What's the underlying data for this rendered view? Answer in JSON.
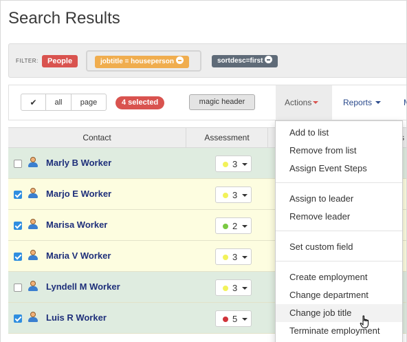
{
  "page": {
    "title": "Search Results"
  },
  "filter": {
    "label": "FILTER:",
    "tags": [
      {
        "text": "People",
        "color": "#d9534f"
      },
      {
        "text": "jobtitle = houseperson",
        "color": "#f0ad4e"
      },
      {
        "text": "sortdesc=first",
        "color": "#5f6b78"
      }
    ]
  },
  "toolbar": {
    "check_glyph": "✔",
    "all_label": "all",
    "page_label": "page",
    "selected_badge": "4 selected",
    "magic_header": "magic header",
    "actions_label": "Actions",
    "reports_label": "Reports",
    "more_label": "M"
  },
  "table": {
    "headers": {
      "contact": "Contact",
      "assessment": "Assessment",
      "more": "s"
    },
    "rows": [
      {
        "name": "Marly B Worker",
        "checked": false,
        "assessment": "3",
        "dot_color": "#f2f25a",
        "shade": "green"
      },
      {
        "name": "Marjo E Worker",
        "checked": true,
        "assessment": "3",
        "dot_color": "#f2f25a",
        "shade": "yellow"
      },
      {
        "name": "Marisa Worker",
        "checked": true,
        "assessment": "2",
        "dot_color": "#7ac943",
        "shade": "yellow"
      },
      {
        "name": "Maria V Worker",
        "checked": true,
        "assessment": "3",
        "dot_color": "#f2f25a",
        "shade": "yellow"
      },
      {
        "name": "Lyndell M Worker",
        "checked": false,
        "assessment": "3",
        "dot_color": "#f2f25a",
        "shade": "green"
      },
      {
        "name": "Luis R Worker",
        "checked": true,
        "assessment": "5",
        "dot_color": "#d0333a",
        "shade": "green"
      }
    ]
  },
  "actions_menu": {
    "groups": [
      [
        "Add to list",
        "Remove from list",
        "Assign Event Steps"
      ],
      [
        "Assign to leader",
        "Remove leader"
      ],
      [
        "Set custom field"
      ],
      [
        "Create employment",
        "Change department",
        "Change job title",
        "Terminate employment"
      ]
    ],
    "hovered": "Change job title"
  }
}
